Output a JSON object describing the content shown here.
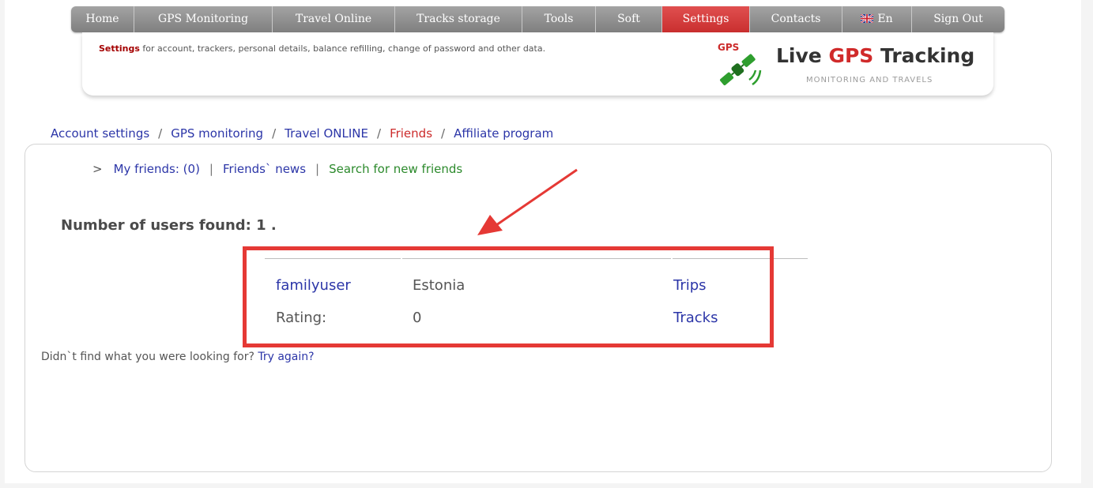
{
  "nav": {
    "items": [
      {
        "label": "Home"
      },
      {
        "label": "GPS Monitoring"
      },
      {
        "label": "Travel Online"
      },
      {
        "label": "Tracks storage"
      },
      {
        "label": "Tools"
      },
      {
        "label": "Soft"
      },
      {
        "label": "Settings",
        "active": true
      },
      {
        "label": "Contacts"
      },
      {
        "label": "En",
        "icon": "uk-flag-icon"
      },
      {
        "label": "Sign Out"
      }
    ]
  },
  "header": {
    "desc_strong": "Settings",
    "desc_rest": " for account, trackers, personal details, balance refilling, change of password and other data.",
    "logo_gps": "GPS",
    "logo_title_a": "Live ",
    "logo_title_b": "GPS",
    "logo_title_c": " Tracking",
    "logo_sub": "MONITORING AND TRAVELS"
  },
  "breadcrumb": {
    "items": [
      "Account settings",
      "GPS monitoring",
      "Travel ONLINE",
      "Friends",
      "Affiliate program"
    ],
    "current": "Friends",
    "separator": "/"
  },
  "subnav": {
    "marker": ">",
    "my_friends": "My friends: (0)",
    "friends_news": "Friends` news",
    "search": "Search for new friends",
    "separator": "|"
  },
  "results": {
    "found_text": "Number of users found: 1 .",
    "user": {
      "name": "familyuser",
      "country": "Estonia",
      "trips_label": "Trips",
      "rating_label": "Rating:",
      "rating_value": "0",
      "tracks_label": "Tracks"
    }
  },
  "not_found": {
    "text": "Didn`t find what you were looking for? ",
    "link": "Try again?"
  },
  "colors": {
    "nav_gray": "#8f8f8f",
    "nav_active": "#d63b3b",
    "link_blue": "#2c36a8",
    "green": "#2c8a2c",
    "highlight_red": "#e53935"
  }
}
